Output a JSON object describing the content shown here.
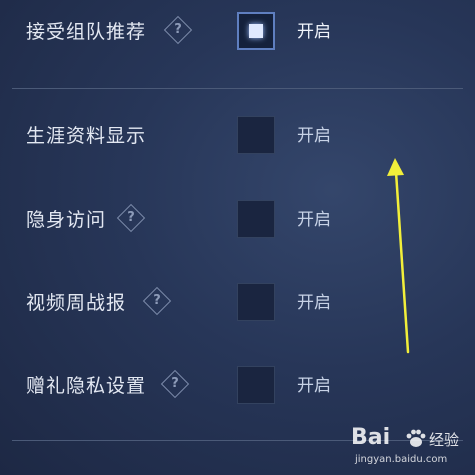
{
  "settings": {
    "items": [
      {
        "label": "接受组队推荐",
        "has_help": true,
        "checked": true,
        "state_text": "开启"
      },
      {
        "label": "生涯资料显示",
        "has_help": false,
        "checked": false,
        "state_text": "开启"
      },
      {
        "label": "隐身访问",
        "has_help": true,
        "checked": false,
        "state_text": "开启"
      },
      {
        "label": "视频周战报",
        "has_help": true,
        "checked": false,
        "state_text": "开启"
      },
      {
        "label": "赠礼隐私设置",
        "has_help": true,
        "checked": false,
        "state_text": "开启"
      }
    ],
    "help_glyph": "?"
  },
  "annotation": {
    "icon": "arrow-up-icon",
    "color": "#f2ef3a"
  },
  "watermark": {
    "brand": "Bai",
    "product": "经验",
    "url": "jingyan.baidu.com"
  },
  "colors": {
    "background": "#273658",
    "accent": "#5f7fc0",
    "text": "#e3e8f2"
  }
}
